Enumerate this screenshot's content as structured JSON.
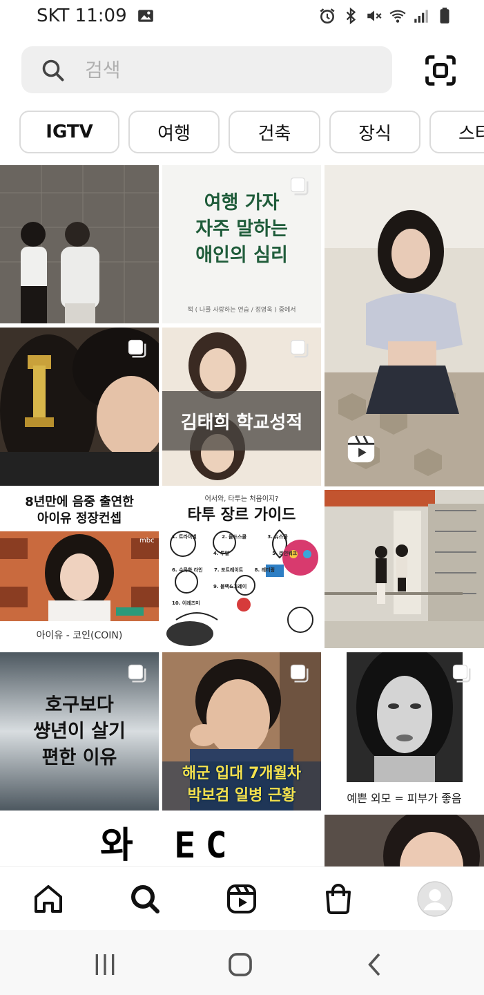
{
  "status_bar": {
    "carrier_time": "SKT 11:09"
  },
  "search": {
    "placeholder": "검색"
  },
  "chips": [
    "IGTV",
    "여행",
    "건축",
    "장식",
    "스타"
  ],
  "tiles": {
    "t2_lines": [
      "여행 가자",
      "자주 말하는",
      "애인의 심리"
    ],
    "t2_caption": "책 ( 나를 사랑하는 연습 / 정영욱 ) 중에서",
    "t5_text": "김태희 학교성적",
    "t7_lines": [
      "8년만에 음중 출연한",
      "아이유 정장컨셉"
    ],
    "t7_caption": "아이유 - 코인(COIN)",
    "t7_logo": "mbc",
    "t8_small": "어서와, 타투는 처음이지?",
    "t8_title": "타투 장르 가이드",
    "t8_items": [
      "1. 트라이벌",
      "2. 올드스쿨",
      "3. 뉴스쿨",
      "4. 투얼",
      "5. 라인워크",
      "6. 수묵화 라인",
      "7. 포트레이트",
      "8. 레터링",
      "9. 블랙&그레이",
      "10. 이레즈미"
    ],
    "t10_lines": [
      "호구보다",
      "썅년이 살기",
      "편한 이유"
    ],
    "t11_lines": [
      "해군 입대 7개월차",
      "박보검 일병 근황"
    ],
    "t12_caption": "예쁜 외모 = 피부가 좋음",
    "t13_text": "와 EC"
  },
  "colors": {
    "green_text": "#1f5c3a",
    "chip_border": "#dbdbdb",
    "search_bg": "#efefef",
    "yellow_text": "#f4e04d"
  },
  "icons": {
    "nav": [
      "home-icon",
      "search-icon",
      "reels-icon",
      "shop-icon",
      "profile-avatar"
    ],
    "system": [
      "recents-icon",
      "home-circle-icon",
      "back-icon"
    ]
  }
}
